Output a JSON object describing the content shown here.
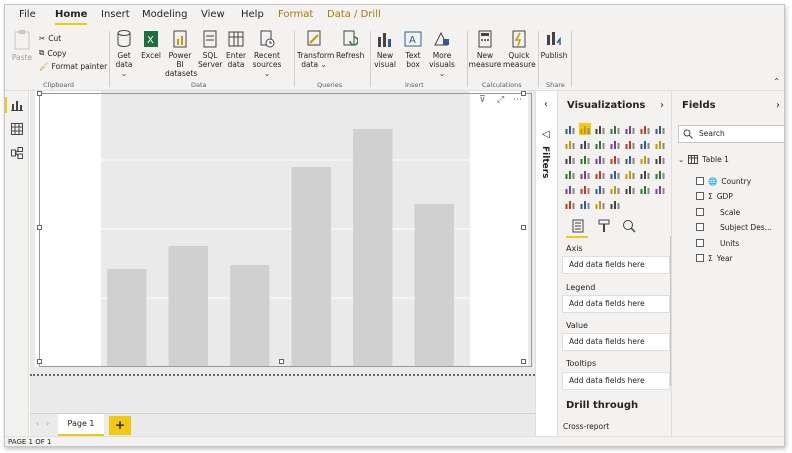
{
  "ribbon_tabs": [
    "File",
    "Home",
    "Insert",
    "Modeling",
    "View",
    "Help",
    "Format",
    "Data / Drill"
  ],
  "clipboard": {
    "paste_label": "Paste",
    "cut_label": "Cut",
    "copy_label": "Copy",
    "format_painter_label": "Format painter",
    "group_label": "Clipboard"
  },
  "data_group": {
    "buttons": [
      "Get data ⌄",
      "Excel",
      "Power BI datasets",
      "SQL Server",
      "Enter data",
      "Recent sources ⌄"
    ],
    "group_label": "Data"
  },
  "queries_group": {
    "buttons": [
      "Transform data ⌄",
      "Refresh"
    ],
    "group_label": "Queries"
  },
  "insert_group": {
    "buttons": [
      "New visual",
      "Text box",
      "More visuals ⌄"
    ],
    "group_label": "Insert"
  },
  "calculations_group": {
    "buttons": [
      "New measure",
      "Quick measure"
    ],
    "group_label": "Calculations"
  },
  "share_group": {
    "buttons": [
      "Publish"
    ],
    "group_label": "Share"
  },
  "chart_data": {
    "type": "bar",
    "categories": [
      "",
      "",
      "",
      "",
      "",
      ""
    ],
    "values": [
      98,
      121,
      102,
      200,
      238,
      163
    ],
    "ylim": [
      0,
      276
    ],
    "title": "",
    "xlabel": "",
    "ylabel": "",
    "grid": true,
    "bar_color": "#d0d0d0"
  },
  "pages": {
    "tabs": [
      "Page 1"
    ],
    "add_label": "+"
  },
  "status": {
    "text": "PAGE 1 OF 1"
  },
  "filters": {
    "label": "Filters"
  },
  "visualizations": {
    "title": "Visualizations",
    "wells": [
      {
        "label": "Axis",
        "placeholder": "Add data fields here"
      },
      {
        "label": "Legend",
        "placeholder": "Add data fields here"
      },
      {
        "label": "Value",
        "placeholder": "Add data fields here"
      },
      {
        "label": "Tooltips",
        "placeholder": "Add data fields here"
      }
    ],
    "drill_through_title": "Drill through",
    "cross_report_label": "Cross-report"
  },
  "fields": {
    "title": "Fields",
    "search_placeholder": "Search",
    "table_name": "Table 1",
    "items": [
      {
        "name": "Country",
        "kind": "globe-icon"
      },
      {
        "name": "GDP",
        "kind": "sigma-icon"
      },
      {
        "name": "Scale",
        "kind": ""
      },
      {
        "name": "Subject Des...",
        "kind": ""
      },
      {
        "name": "Units",
        "kind": ""
      },
      {
        "name": "Year",
        "kind": "sigma-icon"
      }
    ]
  },
  "colors": {
    "accent": "#f2c811",
    "ribbon_bg": "#f3f2f1",
    "bar": "#d0d0d0",
    "format_tab": "#a67c00"
  }
}
